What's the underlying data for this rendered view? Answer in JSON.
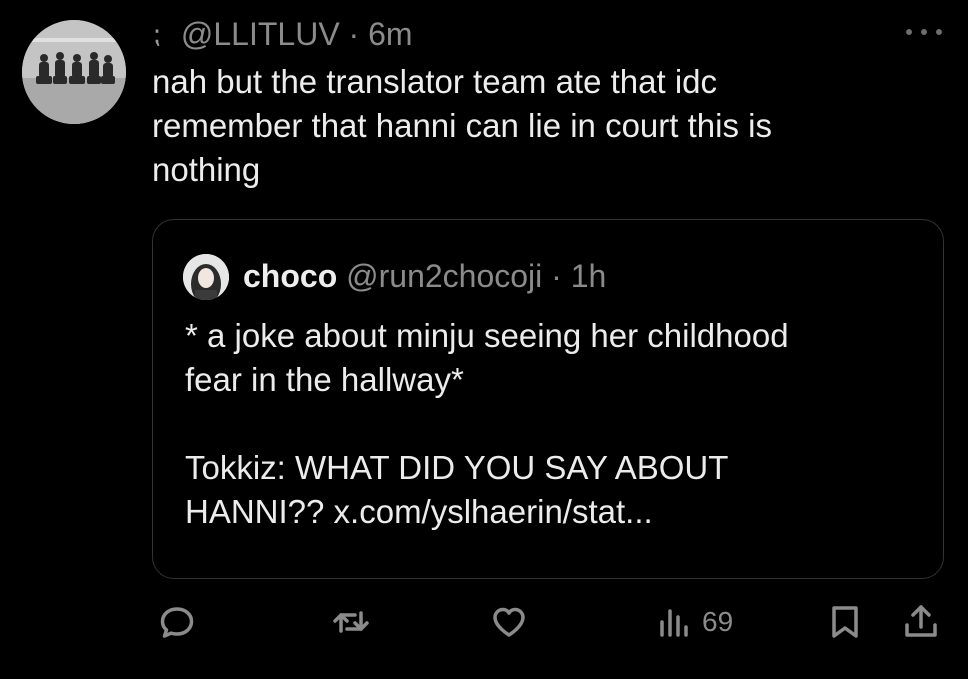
{
  "tweet": {
    "handle": "@LLITLUV",
    "separator": "·",
    "time": "6m",
    "text_lines": [
      "nah but the translator team ate that idc",
      "remember that hanni can lie in court this is",
      "nothing"
    ]
  },
  "quote": {
    "name": "choco",
    "handle": "@run2chocoji",
    "separator": "·",
    "time": "1h",
    "text_lines": [
      "* a joke about minju seeing her childhood",
      "fear in the hallway*",
      "",
      "Tokkiz: WHAT DID YOU SAY ABOUT",
      "HANNI?? x.com/yslhaerin/stat..."
    ]
  },
  "actions": {
    "reply_icon": "reply-icon",
    "retweet_icon": "retweet-icon",
    "like_icon": "heart-icon",
    "views_icon": "views-icon",
    "views_count": "69",
    "bookmark_icon": "bookmark-icon",
    "share_icon": "share-icon"
  },
  "colors": {
    "background": "#000000",
    "text": "#ececec",
    "secondary_text": "#8b8b8b",
    "border": "#2f3336"
  }
}
